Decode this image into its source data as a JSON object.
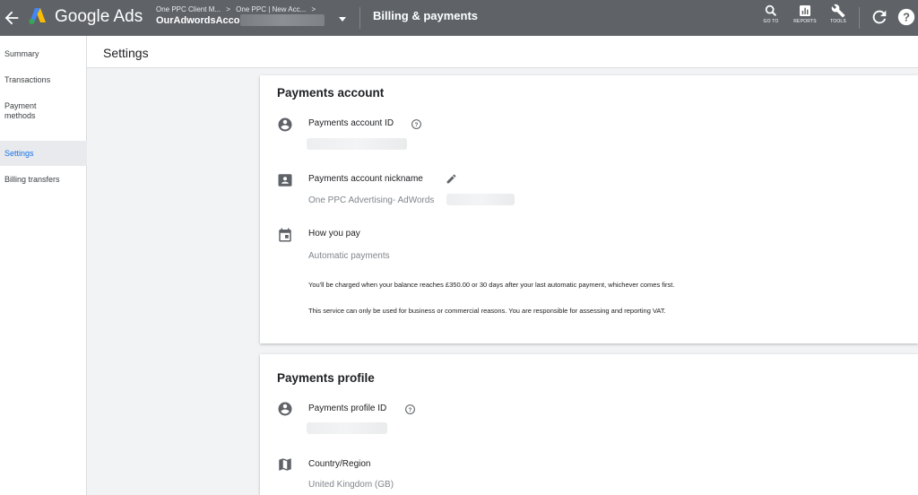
{
  "topbar": {
    "brand": "Google Ads",
    "breadcrumbs": [
      "One PPC Client M...",
      ">",
      "One PPC | New Acc...",
      ">"
    ],
    "account_name": "OurAdwordsAccour",
    "page_heading": "Billing & payments",
    "tools": [
      {
        "label": "GO TO",
        "icon": "search-icon"
      },
      {
        "label": "REPORTS",
        "icon": "reports-icon"
      },
      {
        "label": "TOOLS",
        "icon": "wrench-icon"
      }
    ],
    "bar_color": "#5f6368"
  },
  "sidebar": {
    "items": [
      {
        "label": "Summary"
      },
      {
        "label": "Transactions"
      },
      {
        "label": "Payment methods"
      },
      {
        "label": "Settings",
        "active": true
      },
      {
        "label": "Billing transfers"
      }
    ],
    "active_color": "#1a73e8"
  },
  "settings": {
    "title": "Settings"
  },
  "payments_account": {
    "title": "Payments account",
    "id_label": "Payments account ID",
    "nickname_label": "Payments account nickname",
    "nickname_value": "One PPC Advertising- AdWords",
    "how_you_pay_label": "How you pay",
    "how_you_pay_value": "Automatic payments",
    "note1": "You'll be charged when your balance reaches £350.00 or 30 days after your last automatic payment, whichever comes first.",
    "note2": "This service can only be used for business or commercial reasons. You are responsible for assessing and reporting VAT."
  },
  "payments_profile": {
    "title": "Payments profile",
    "id_label": "Payments profile ID",
    "country_label": "Country/Region",
    "country_value": "United Kingdom (GB)"
  }
}
